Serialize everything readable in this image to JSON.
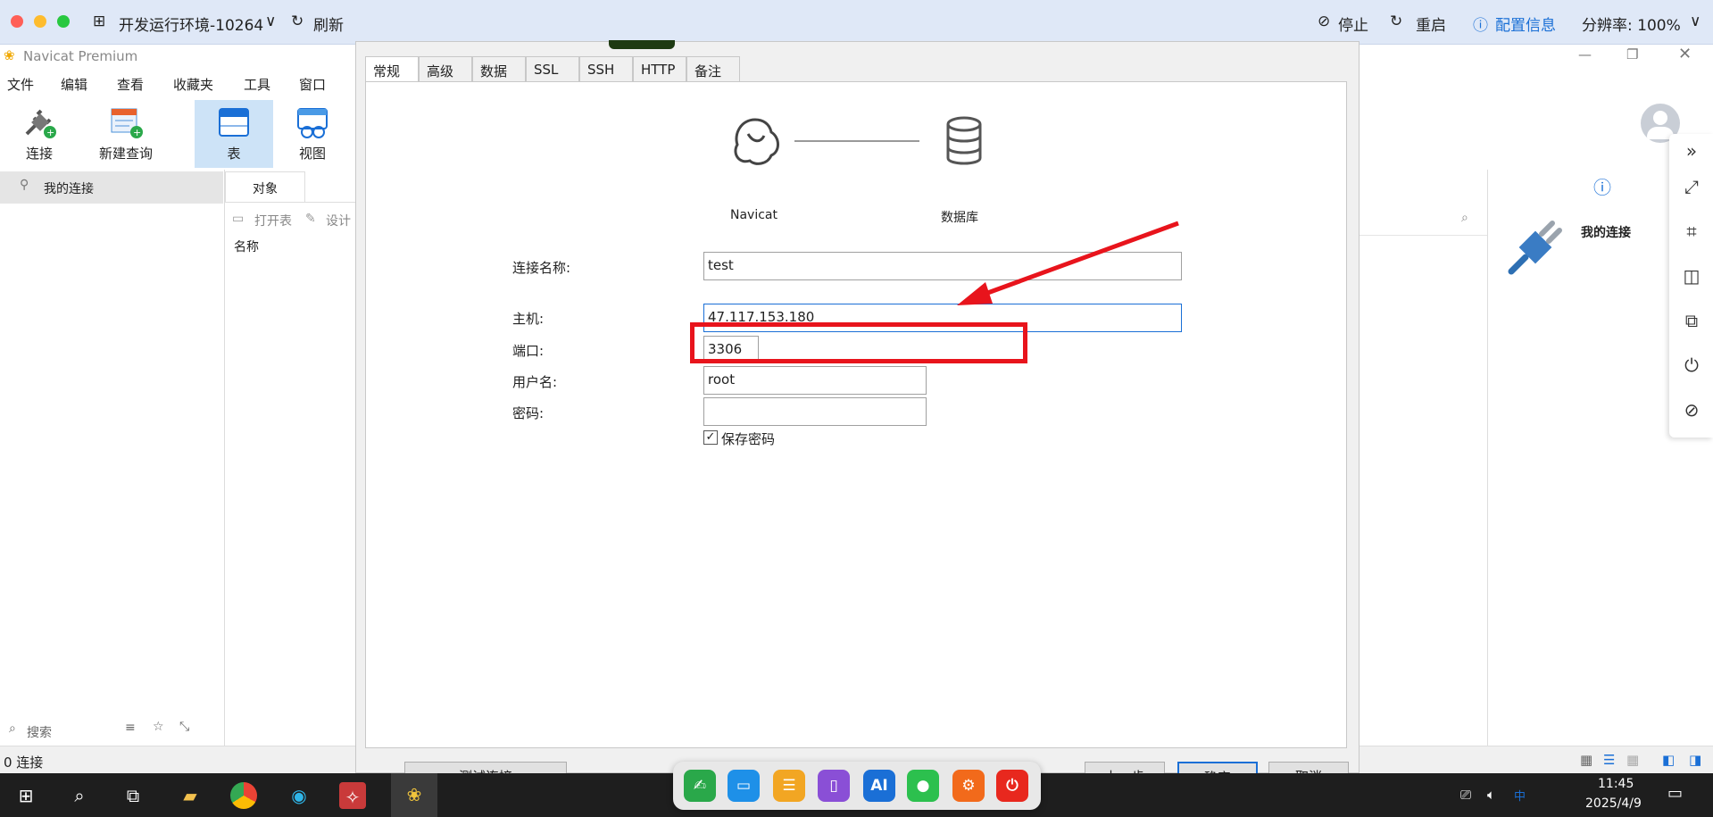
{
  "remote_bar": {
    "env_title": "开发运行环境-10264",
    "refresh": "刷新",
    "stop": "停止",
    "restart": "重启",
    "config": "配置信息",
    "resolution": "分辨率: 100%"
  },
  "app": {
    "title": "Navicat Premium",
    "menu": [
      "文件",
      "编辑",
      "查看",
      "收藏夹",
      "工具",
      "窗口"
    ],
    "toolbar": [
      "连接",
      "新建查询",
      "表",
      "视图"
    ],
    "left_tree": {
      "item": "我的连接"
    },
    "objects": {
      "tab": "对象",
      "open_table": "打开表",
      "design": "设计",
      "name_header": "名称"
    },
    "search_placeholder": "搜索",
    "status": "0 连接",
    "right_panel_title": "我的连接"
  },
  "dialog": {
    "tabs": [
      "常规",
      "高级",
      "数据库",
      "SSL",
      "SSH",
      "HTTP",
      "备注"
    ],
    "navicat_label": "Navicat",
    "database_label": "数据库",
    "fields": {
      "conn_name_label": "连接名称:",
      "conn_name_value": "test",
      "host_label": "主机:",
      "host_value": "47.117.153.180",
      "port_label": "端口:",
      "port_value": "3306",
      "user_label": "用户名:",
      "user_value": "root",
      "password_label": "密码:",
      "password_value": "",
      "save_password": "保存密码"
    },
    "buttons": {
      "test": "测试连接",
      "prev": "上一步",
      "ok": "确定",
      "cancel": "取消"
    }
  },
  "taskbar": {
    "time": "11:45",
    "date": "2025/4/9",
    "ime": "中"
  },
  "dock_apps": [
    "sign",
    "screen",
    "files",
    "book",
    "AI",
    "chat",
    "settings",
    "power"
  ],
  "colors": {
    "annotation_red": "#e8141c",
    "accent_blue": "#1a6fd6"
  }
}
